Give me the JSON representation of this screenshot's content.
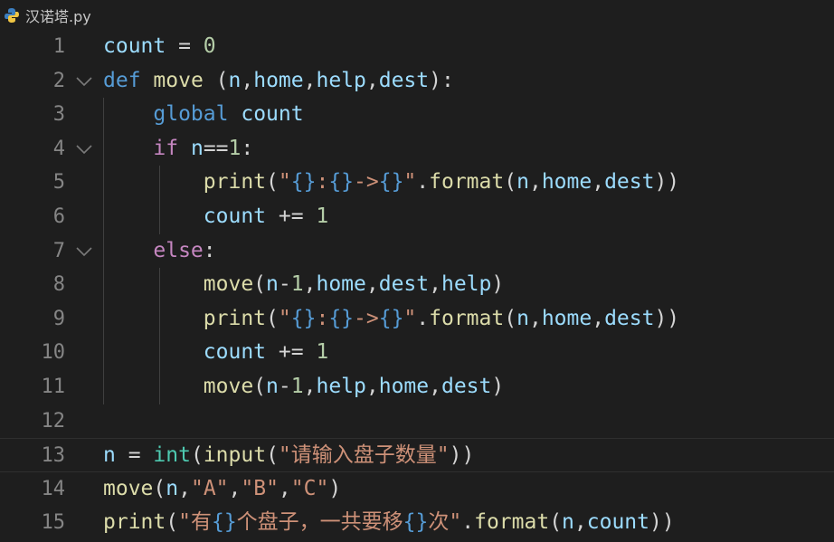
{
  "breadcrumb": {
    "filename": "汉诺塔.py"
  },
  "editor": {
    "current_line": 13,
    "lines": [
      {
        "num": "1",
        "fold": false,
        "tokens": [
          [
            "count",
            "t-var"
          ],
          [
            " = ",
            "t-op"
          ],
          [
            "0",
            "t-num"
          ]
        ]
      },
      {
        "num": "2",
        "fold": true,
        "tokens": [
          [
            "def",
            "t-kw"
          ],
          [
            " ",
            "t-op"
          ],
          [
            "move",
            "t-fn"
          ],
          [
            " (",
            "t-op"
          ],
          [
            "n",
            "t-var"
          ],
          [
            ",",
            "t-op"
          ],
          [
            "home",
            "t-var"
          ],
          [
            ",",
            "t-op"
          ],
          [
            "help",
            "t-var"
          ],
          [
            ",",
            "t-op"
          ],
          [
            "dest",
            "t-var"
          ],
          [
            "):",
            "t-op"
          ]
        ]
      },
      {
        "num": "3",
        "fold": false,
        "tokens": [
          [
            "    ",
            "t-op"
          ],
          [
            "global",
            "t-kw"
          ],
          [
            " ",
            "t-op"
          ],
          [
            "count",
            "t-var"
          ]
        ]
      },
      {
        "num": "4",
        "fold": true,
        "tokens": [
          [
            "    ",
            "t-op"
          ],
          [
            "if",
            "t-ctl"
          ],
          [
            " ",
            "t-op"
          ],
          [
            "n",
            "t-var"
          ],
          [
            "==",
            "t-op"
          ],
          [
            "1",
            "t-num"
          ],
          [
            ":",
            "t-op"
          ]
        ]
      },
      {
        "num": "5",
        "fold": false,
        "tokens": [
          [
            "        ",
            "t-op"
          ],
          [
            "print",
            "t-fn"
          ],
          [
            "(",
            "t-op"
          ],
          [
            "\"",
            "t-str"
          ],
          [
            "{}",
            "t-esc"
          ],
          [
            ":",
            "t-str"
          ],
          [
            "{}",
            "t-esc"
          ],
          [
            "->",
            "t-str"
          ],
          [
            "{}",
            "t-esc"
          ],
          [
            "\"",
            "t-str"
          ],
          [
            ".",
            "t-op"
          ],
          [
            "format",
            "t-fn"
          ],
          [
            "(",
            "t-op"
          ],
          [
            "n",
            "t-var"
          ],
          [
            ",",
            "t-op"
          ],
          [
            "home",
            "t-var"
          ],
          [
            ",",
            "t-op"
          ],
          [
            "dest",
            "t-var"
          ],
          [
            "))",
            "t-op"
          ]
        ]
      },
      {
        "num": "6",
        "fold": false,
        "tokens": [
          [
            "        ",
            "t-op"
          ],
          [
            "count",
            "t-var"
          ],
          [
            " += ",
            "t-op"
          ],
          [
            "1",
            "t-num"
          ]
        ]
      },
      {
        "num": "7",
        "fold": true,
        "tokens": [
          [
            "    ",
            "t-op"
          ],
          [
            "else",
            "t-ctl"
          ],
          [
            ":",
            "t-op"
          ]
        ]
      },
      {
        "num": "8",
        "fold": false,
        "tokens": [
          [
            "        ",
            "t-op"
          ],
          [
            "move",
            "t-fn"
          ],
          [
            "(",
            "t-op"
          ],
          [
            "n",
            "t-var"
          ],
          [
            "-",
            "t-op"
          ],
          [
            "1",
            "t-num"
          ],
          [
            ",",
            "t-op"
          ],
          [
            "home",
            "t-var"
          ],
          [
            ",",
            "t-op"
          ],
          [
            "dest",
            "t-var"
          ],
          [
            ",",
            "t-op"
          ],
          [
            "help",
            "t-var"
          ],
          [
            ")",
            "t-op"
          ]
        ]
      },
      {
        "num": "9",
        "fold": false,
        "tokens": [
          [
            "        ",
            "t-op"
          ],
          [
            "print",
            "t-fn"
          ],
          [
            "(",
            "t-op"
          ],
          [
            "\"",
            "t-str"
          ],
          [
            "{}",
            "t-esc"
          ],
          [
            ":",
            "t-str"
          ],
          [
            "{}",
            "t-esc"
          ],
          [
            "->",
            "t-str"
          ],
          [
            "{}",
            "t-esc"
          ],
          [
            "\"",
            "t-str"
          ],
          [
            ".",
            "t-op"
          ],
          [
            "format",
            "t-fn"
          ],
          [
            "(",
            "t-op"
          ],
          [
            "n",
            "t-var"
          ],
          [
            ",",
            "t-op"
          ],
          [
            "home",
            "t-var"
          ],
          [
            ",",
            "t-op"
          ],
          [
            "dest",
            "t-var"
          ],
          [
            "))",
            "t-op"
          ]
        ]
      },
      {
        "num": "10",
        "fold": false,
        "tokens": [
          [
            "        ",
            "t-op"
          ],
          [
            "count",
            "t-var"
          ],
          [
            " += ",
            "t-op"
          ],
          [
            "1",
            "t-num"
          ]
        ]
      },
      {
        "num": "11",
        "fold": false,
        "tokens": [
          [
            "        ",
            "t-op"
          ],
          [
            "move",
            "t-fn"
          ],
          [
            "(",
            "t-op"
          ],
          [
            "n",
            "t-var"
          ],
          [
            "-",
            "t-op"
          ],
          [
            "1",
            "t-num"
          ],
          [
            ",",
            "t-op"
          ],
          [
            "help",
            "t-var"
          ],
          [
            ",",
            "t-op"
          ],
          [
            "home",
            "t-var"
          ],
          [
            ",",
            "t-op"
          ],
          [
            "dest",
            "t-var"
          ],
          [
            ")",
            "t-op"
          ]
        ]
      },
      {
        "num": "12",
        "fold": false,
        "tokens": []
      },
      {
        "num": "13",
        "fold": false,
        "tokens": [
          [
            "n",
            "t-var"
          ],
          [
            " = ",
            "t-op"
          ],
          [
            "int",
            "t-bi"
          ],
          [
            "(",
            "t-op"
          ],
          [
            "input",
            "t-fn"
          ],
          [
            "(",
            "t-op"
          ],
          [
            "\"请输入盘子数量\"",
            "t-str"
          ],
          [
            "))",
            "t-op"
          ]
        ]
      },
      {
        "num": "14",
        "fold": false,
        "tokens": [
          [
            "move",
            "t-fn"
          ],
          [
            "(",
            "t-op"
          ],
          [
            "n",
            "t-var"
          ],
          [
            ",",
            "t-op"
          ],
          [
            "\"A\"",
            "t-str"
          ],
          [
            ",",
            "t-op"
          ],
          [
            "\"B\"",
            "t-str"
          ],
          [
            ",",
            "t-op"
          ],
          [
            "\"C\"",
            "t-str"
          ],
          [
            ")",
            "t-op"
          ]
        ]
      },
      {
        "num": "15",
        "fold": false,
        "tokens": [
          [
            "print",
            "t-fn"
          ],
          [
            "(",
            "t-op"
          ],
          [
            "\"有",
            "t-str"
          ],
          [
            "{}",
            "t-esc"
          ],
          [
            "个盘子，一共要移",
            "t-str"
          ],
          [
            "{}",
            "t-esc"
          ],
          [
            "次\"",
            "t-str"
          ],
          [
            ".",
            "t-op"
          ],
          [
            "format",
            "t-fn"
          ],
          [
            "(",
            "t-op"
          ],
          [
            "n",
            "t-var"
          ],
          [
            ",",
            "t-op"
          ],
          [
            "count",
            "t-var"
          ],
          [
            "))",
            "t-op"
          ]
        ]
      }
    ]
  }
}
